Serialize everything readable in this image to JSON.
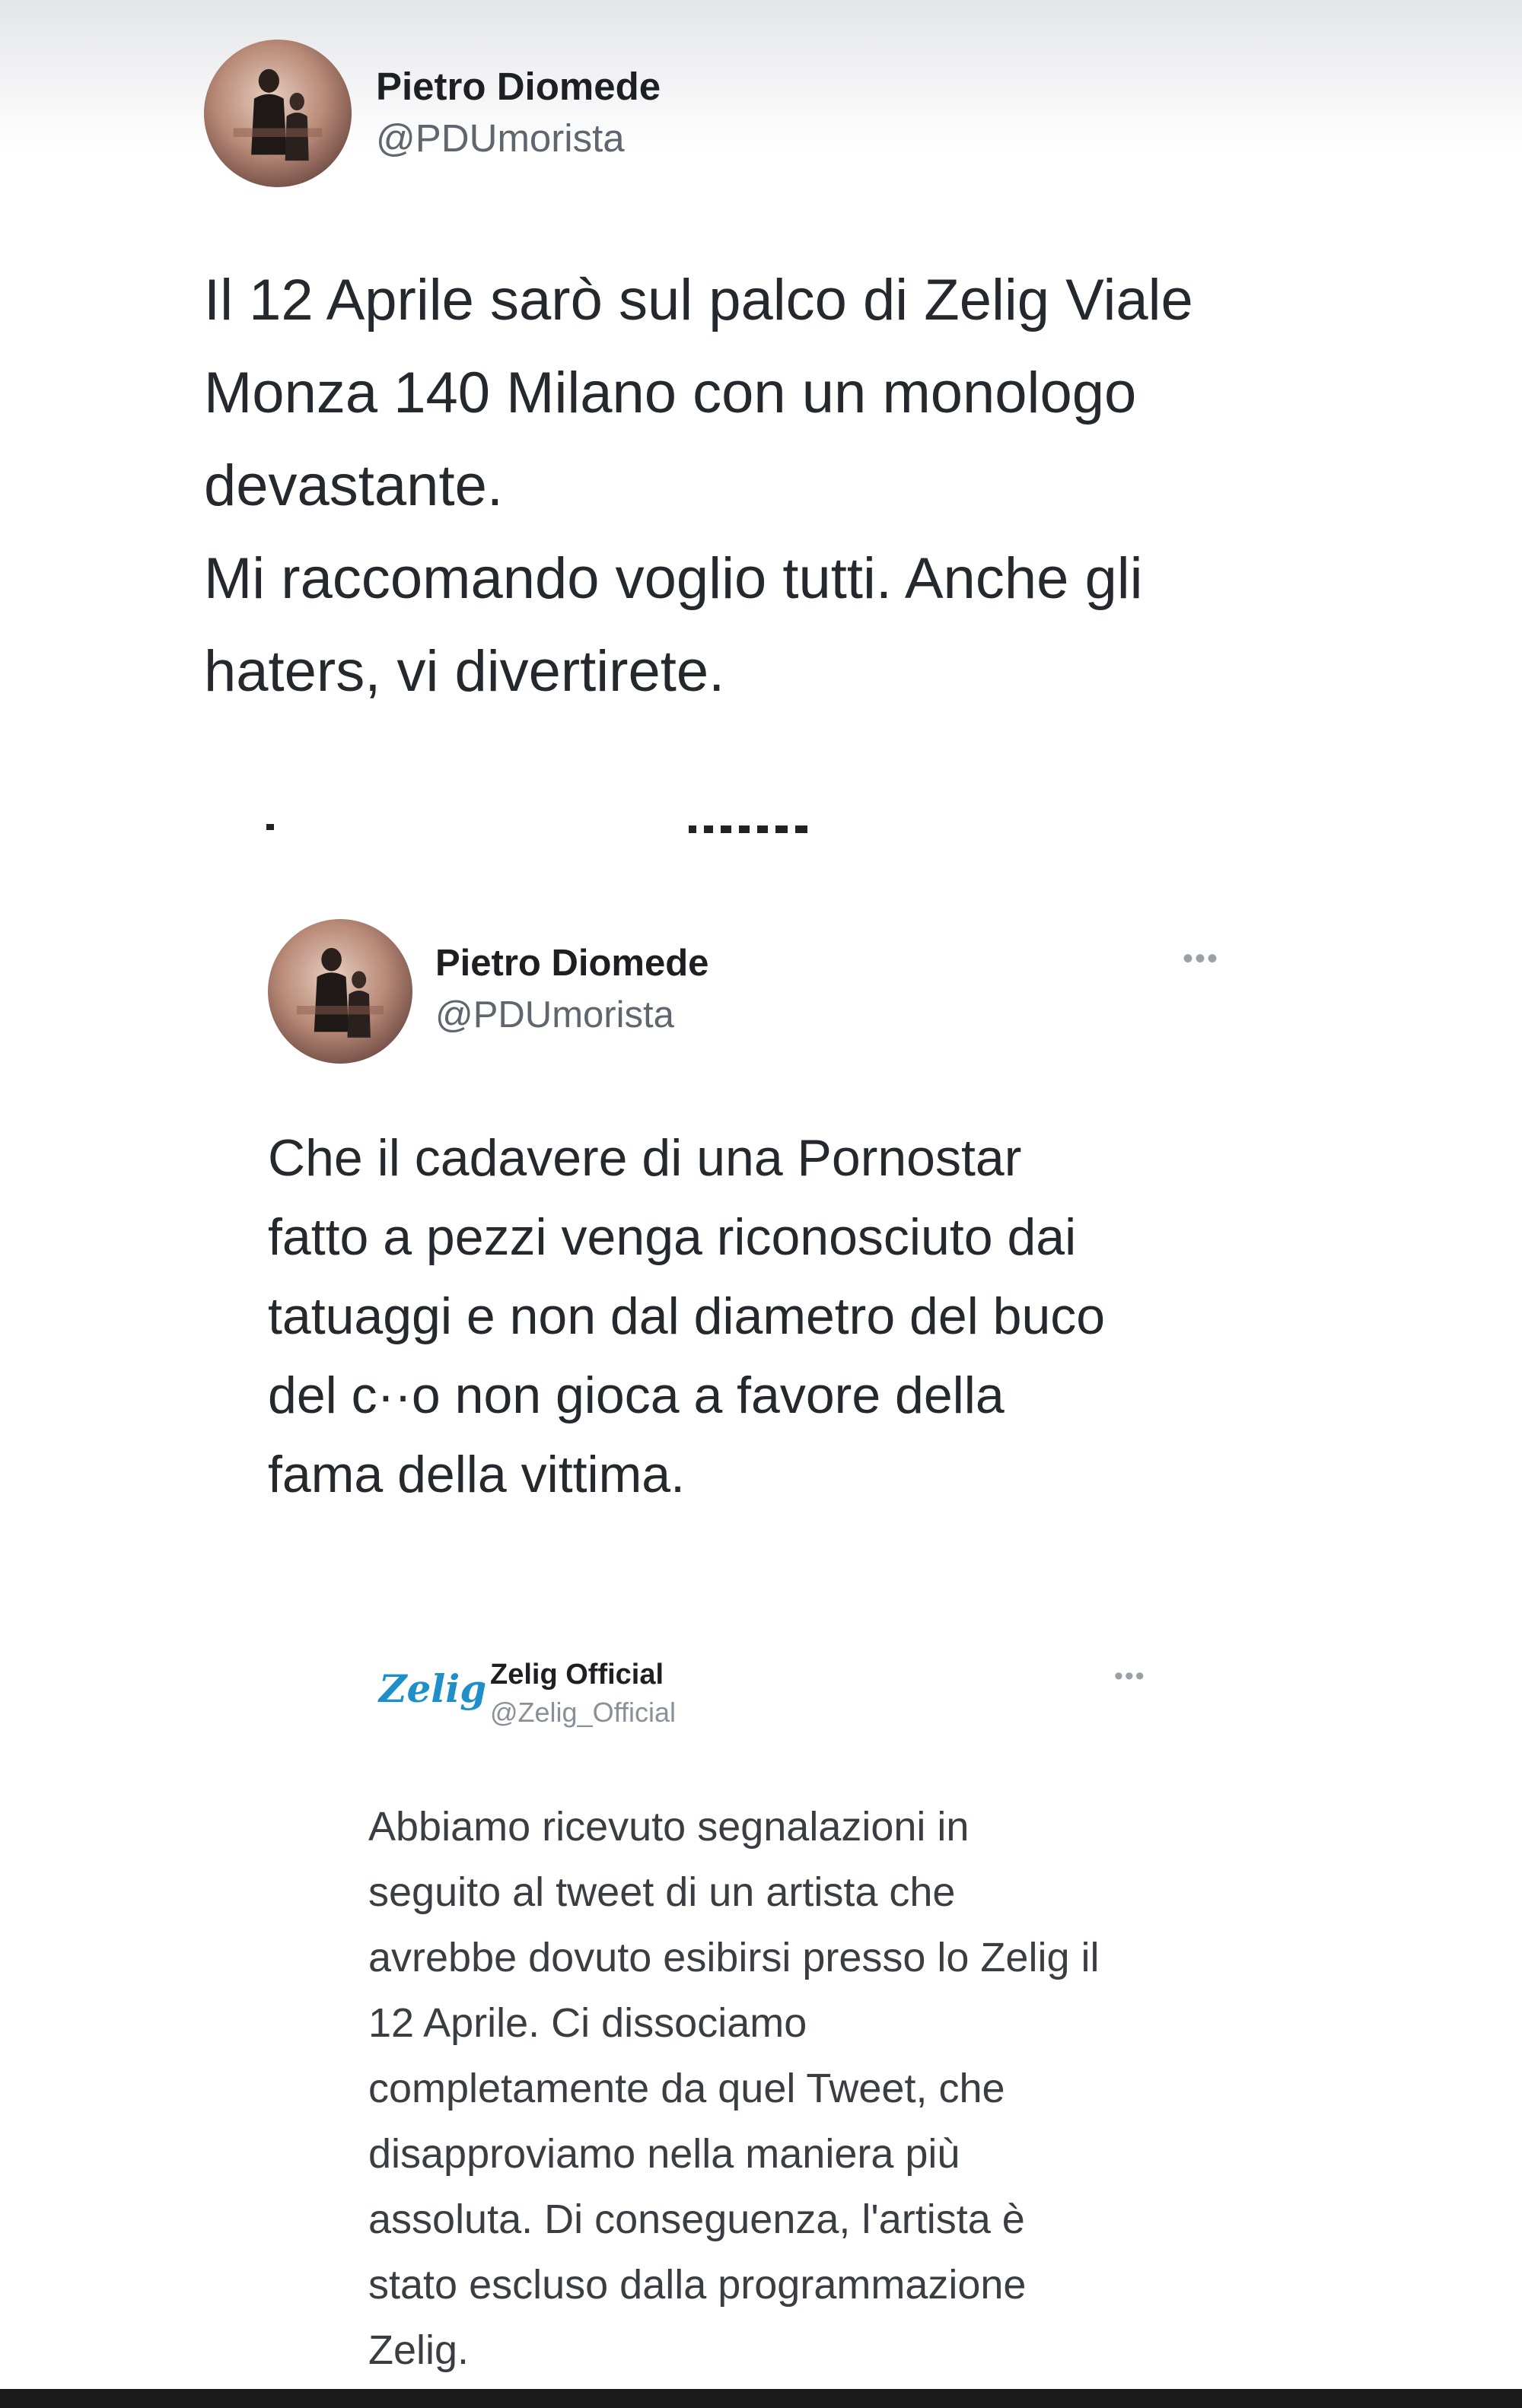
{
  "tweets": [
    {
      "author_name": "Pietro Diomede",
      "handle": "@PDUmorista",
      "text": "Il 12 Aprile sarò sul palco di Zelig Viale\nMonza 140 Milano con un monologo\ndevastante.\nMi raccomando voglio tutti. Anche gli\nhaters, vi divertirete."
    },
    {
      "author_name": "Pietro Diomede",
      "handle": "@PDUmorista",
      "text": "Che il cadavere di una Pornostar\nfatto a pezzi venga riconosciuto dai\ntatuaggi e non dal diametro del buco\ndel c··o non gioca a favore della\nfama della vittima.",
      "more_icon": "more-horizontal-icon"
    },
    {
      "logo_text": "Zelig",
      "author_name": "Zelig Official",
      "handle": "@Zelig_Official",
      "text": "Abbiamo ricevuto segnalazioni in\nseguito al tweet di un artista che\navrebbe dovuto esibirsi presso lo Zelig il\n12 Aprile. Ci dissociamo\ncompletamente da quel Tweet, che\ndisapproviamo nella maniera più\nassoluta. Di conseguenza, l'artista è\nstato escluso dalla programmazione\nZelig.",
      "more_icon": "more-horizontal-icon",
      "logo_color": "#1e8fc8"
    }
  ],
  "colors": {
    "text_primary": "#25282c",
    "text_secondary": "#5f666e",
    "background": "#ffffff"
  }
}
